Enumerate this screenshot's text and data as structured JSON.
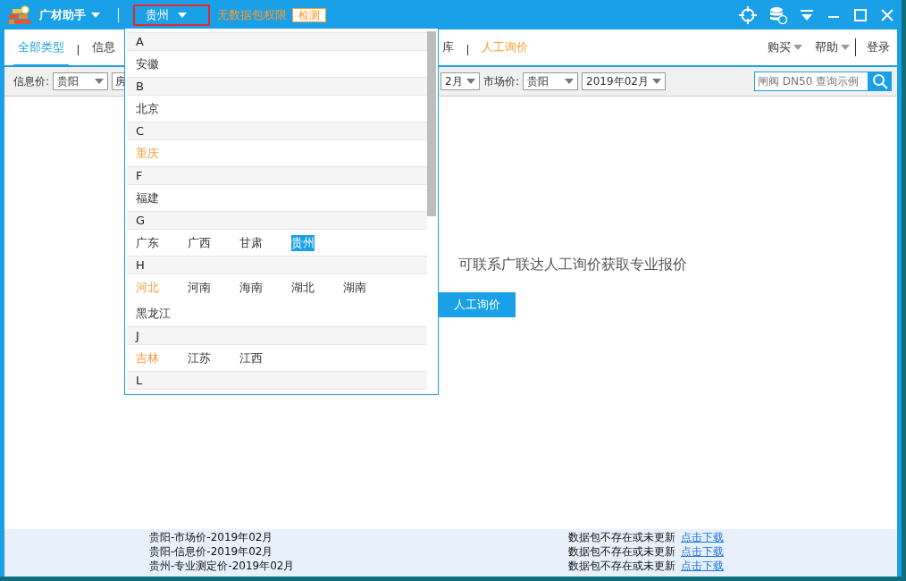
{
  "title_bar": {
    "app_name": "广材助手",
    "city": "贵州",
    "permission_notice": "无数据包权限",
    "check_button": "检测"
  },
  "tabs": [
    {
      "label": "全部类型",
      "selected": true,
      "kind": "normal"
    },
    {
      "label": "信息",
      "selected": false,
      "kind": "normal"
    },
    {
      "label": "库",
      "selected": false,
      "kind": "normal"
    },
    {
      "label": "人工询价",
      "selected": false,
      "kind": "accent"
    }
  ],
  "menus": [
    "购买",
    "帮助"
  ],
  "login": "登录",
  "filters": {
    "info_label": "信息价:",
    "info_region": "贵阳",
    "info_partial": "房",
    "market_partial": "2月",
    "market_label": "市场价:",
    "market_region": "贵阳",
    "market_date": "2019年02月",
    "search_placeholder": "闸阀 DN50 查询示例"
  },
  "message": "可联系广联达人工询价获取专业报价",
  "action_button": "人工询价",
  "downloads": [
    {
      "name": "贵阳-市场价-2019年02月",
      "status": "数据包不存在或未更新",
      "link": "点击下载"
    },
    {
      "name": "贵阳-信息价-2019年02月",
      "status": "数据包不存在或未更新",
      "link": "点击下载"
    },
    {
      "name": "贵州-专业测定价-2019年02月",
      "status": "数据包不存在或未更新",
      "link": "点击下载"
    }
  ],
  "city_dropdown": {
    "groups": [
      {
        "letter": "A",
        "items": [
          {
            "label": "安徽",
            "selected": false,
            "emphasized": false
          }
        ]
      },
      {
        "letter": "B",
        "items": [
          {
            "label": "北京",
            "selected": false,
            "emphasized": false
          }
        ]
      },
      {
        "letter": "C",
        "items": [
          {
            "label": "重庆",
            "selected": false,
            "emphasized": true
          }
        ]
      },
      {
        "letter": "F",
        "items": [
          {
            "label": "福建",
            "selected": false,
            "emphasized": false
          }
        ]
      },
      {
        "letter": "G",
        "items": [
          {
            "label": "广东",
            "selected": false,
            "emphasized": false
          },
          {
            "label": "广西",
            "selected": false,
            "emphasized": false
          },
          {
            "label": "甘肃",
            "selected": false,
            "emphasized": false
          },
          {
            "label": "贵州",
            "selected": true,
            "emphasized": false
          }
        ]
      },
      {
        "letter": "H",
        "items": [
          {
            "label": "河北",
            "selected": false,
            "emphasized": true
          },
          {
            "label": "河南",
            "selected": false,
            "emphasized": false
          },
          {
            "label": "海南",
            "selected": false,
            "emphasized": false
          },
          {
            "label": "湖北",
            "selected": false,
            "emphasized": false
          },
          {
            "label": "湖南",
            "selected": false,
            "emphasized": false
          },
          {
            "label": "黑龙江",
            "selected": false,
            "emphasized": false
          }
        ]
      },
      {
        "letter": "J",
        "items": [
          {
            "label": "吉林",
            "selected": false,
            "emphasized": true
          },
          {
            "label": "江苏",
            "selected": false,
            "emphasized": false
          },
          {
            "label": "江西",
            "selected": false,
            "emphasized": false
          }
        ]
      },
      {
        "letter": "L"
      }
    ]
  }
}
